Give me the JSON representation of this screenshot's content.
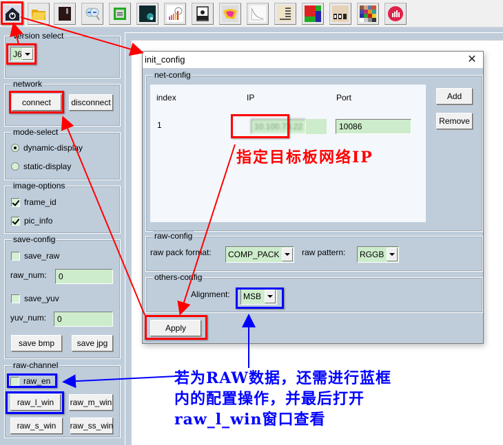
{
  "toolbar": {
    "buttons": [
      {
        "name": "home-init-config",
        "icon": "home-icon"
      },
      {
        "name": "open-folder",
        "icon": "folder-icon"
      },
      {
        "name": "device",
        "icon": "device-icon"
      },
      {
        "name": "zoom-compare",
        "icon": "zoom-compare-icon"
      },
      {
        "name": "chip",
        "icon": "chip-icon"
      },
      {
        "name": "noise",
        "icon": "noise-image-icon"
      },
      {
        "name": "histogram-analysis",
        "icon": "bar-chart-magnifier-icon"
      },
      {
        "name": "raw-file",
        "icon": "raw-file-icon"
      },
      {
        "name": "color-gamut",
        "icon": "color-gamut-icon"
      },
      {
        "name": "curve-plot",
        "icon": "curve-plot-icon"
      },
      {
        "name": "data-table",
        "icon": "data-table-icon"
      },
      {
        "name": "grid-color",
        "icon": "color-grid-icon"
      },
      {
        "name": "gray-scale",
        "icon": "gray-scale-icon"
      },
      {
        "name": "color-checker",
        "icon": "color-checker-icon"
      },
      {
        "name": "statistics",
        "icon": "statistics-icon"
      }
    ]
  },
  "left_panel": {
    "version_select": {
      "title": "version select",
      "value": "J6"
    },
    "network": {
      "title": "network",
      "connect": "connect",
      "disconnect": "disconnect"
    },
    "mode_select": {
      "title": "mode-select",
      "options": [
        "dynamic-display",
        "static-display"
      ],
      "selected": "dynamic-display"
    },
    "image_options": {
      "title": "image-options",
      "frame_id": "frame_id",
      "frame_id_checked": true,
      "pic_info": "pic_info",
      "pic_info_checked": true
    },
    "save_config": {
      "title": "save-config",
      "save_raw": "save_raw",
      "save_raw_checked": false,
      "raw_num_label": "raw_num:",
      "raw_num": "0",
      "save_yuv": "save_yuv",
      "save_yuv_checked": false,
      "yuv_num_label": "yuv_num:",
      "yuv_num": "0",
      "save_bmp": "save bmp",
      "save_jpg": "save jpg"
    },
    "raw_channel": {
      "title": "raw-channel",
      "raw_en": "raw_en",
      "raw_en_checked": false,
      "raw_l_win": "raw_l_win",
      "raw_m_win": "raw_m_win",
      "raw_s_win": "raw_s_win",
      "raw_ss_win": "raw_ss_win"
    }
  },
  "dialog": {
    "title": "init_config",
    "close": "✕",
    "net_config": {
      "title": "net-config",
      "columns": [
        "index",
        "IP",
        "Port"
      ],
      "rows": [
        {
          "index": "1",
          "ip": "10.100.73.22",
          "port": "10086"
        }
      ],
      "add": "Add",
      "remove": "Remove"
    },
    "raw_config": {
      "title": "raw-config",
      "pack_format_label": "raw pack format:",
      "pack_format": "COMP_PACK",
      "pattern_label": "raw pattern:",
      "pattern": "RGGB"
    },
    "others_config": {
      "title": "others-config",
      "alignment_label": "Alignment:",
      "alignment": "MSB"
    },
    "apply": "Apply"
  },
  "annotations": {
    "red_note": "指定目标板网络IP",
    "blue_note_line1": "若为RAW数据，还需进行蓝框",
    "blue_note_line2": "内的配置操作，并最后打开",
    "blue_note_line3_bold": "raw_l_win",
    "blue_note_line3_rest": "窗口查看",
    "red_color": "#ff0000",
    "blue_color": "#0000ff"
  }
}
